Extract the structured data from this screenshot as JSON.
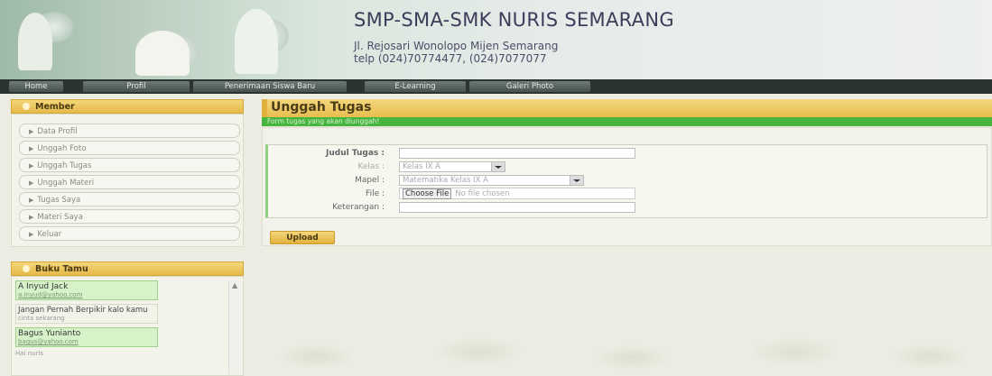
{
  "header": {
    "title": "SMP-SMA-SMK NURIS SEMARANG",
    "address": "Jl. Rejosari Wonolopo Mijen Semarang",
    "phone": "telp (024)70774477, (024)7077077"
  },
  "nav": {
    "items": [
      "Home",
      "Profil",
      "Penerimaan Siswa Baru",
      "E-Learning",
      "Galeri Photo"
    ]
  },
  "sidebar": {
    "member_title": "Member",
    "member_links": [
      "Data Profil",
      "Unggah Foto",
      "Unggah Tugas",
      "Unggah Materi",
      "Tugas Saya",
      "Materi Saya",
      "Keluar"
    ],
    "guestbook_title": "Buku Tamu",
    "guestbook_entries": [
      {
        "name": "A Inyud Jack",
        "email": "a.inyud@yahoo.com",
        "message": "",
        "sub": ""
      },
      {
        "name": "",
        "email": "",
        "message": "Jangan Pernah Berpikir kalo kamu",
        "sub": "cinta sekarang"
      },
      {
        "name": "Bagus Yunianto",
        "email": "bagus@yahoo.com",
        "message": "",
        "sub": "Hai nuris"
      }
    ]
  },
  "main": {
    "title": "Unggah Tugas",
    "notice": "Form tugas yang akan diunggah!",
    "form": {
      "judul_label": "Judul Tugas :",
      "judul_value": "",
      "kelas_label": "Kelas :",
      "kelas_value": "Kelas IX A",
      "mapel_label": "Mapel :",
      "mapel_value": "Matematika Kelas IX A",
      "file_label": "File :",
      "file_button": "Choose File",
      "file_status": "No file chosen",
      "keterangan_label": "Keterangan :",
      "keterangan_value": "",
      "upload_label": "Upload"
    }
  }
}
